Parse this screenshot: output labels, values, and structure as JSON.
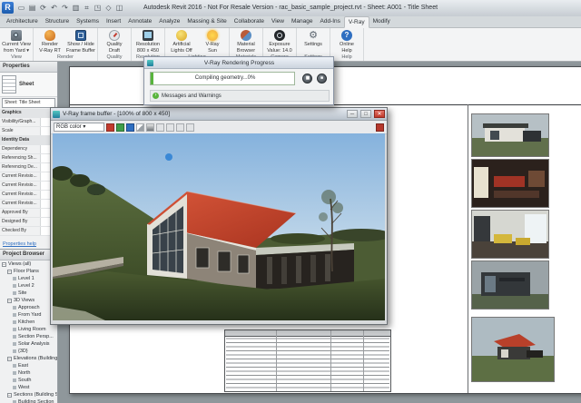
{
  "title_bar": {
    "title": "Autodesk Revit 2016 - Not For Resale Version -   rac_basic_sample_project.rvt - Sheet: A001 - Title Sheet",
    "app_initial": "R",
    "qat": [
      "open",
      "save",
      "sync",
      "undo",
      "redo",
      "print",
      "measure",
      "tag",
      "view-3d",
      "section"
    ]
  },
  "ribbon": {
    "tabs": [
      "Architecture",
      "Structure",
      "Systems",
      "Insert",
      "Annotate",
      "Analyze",
      "Massing & Site",
      "Collaborate",
      "View",
      "Manage",
      "Add-Ins",
      "V-Ray",
      "Modify"
    ],
    "active_tab": "V-Ray",
    "panels": [
      {
        "label": "View",
        "buttons": [
          {
            "line1": "Current View",
            "line2": "from Yard",
            "icon": "camera",
            "dropdown": true
          }
        ]
      },
      {
        "label": "Render",
        "buttons": [
          {
            "line1": "Render",
            "line2": "V-Ray RT",
            "icon": "teapot"
          },
          {
            "line1": "Show / Hide",
            "line2": "Frame Buffer",
            "icon": "framebuffer"
          }
        ]
      },
      {
        "label": "Quality",
        "buttons": [
          {
            "line1": "Quality",
            "line2": "Draft",
            "icon": "quality"
          }
        ]
      },
      {
        "label": "Resolution",
        "buttons": [
          {
            "line1": "Resolution",
            "line2": "800 x 450",
            "icon": "resolution"
          }
        ]
      },
      {
        "label": "Lighting",
        "buttons": [
          {
            "line1": "Artificial",
            "line2": "Lights Off",
            "icon": "bulb"
          },
          {
            "line1": "V-Ray",
            "line2": "Sun",
            "icon": "sun"
          }
        ]
      },
      {
        "label": "Materials",
        "buttons": [
          {
            "line1": "Material",
            "line2": "Browser",
            "icon": "material"
          }
        ]
      },
      {
        "label": "Camera",
        "buttons": [
          {
            "line1": "Exposure",
            "line2": "Value: 14.0",
            "icon": "exposure"
          }
        ]
      },
      {
        "label": "Settings",
        "buttons": [
          {
            "line1": "Settings",
            "line2": "",
            "icon": "gear"
          }
        ]
      },
      {
        "label": "Help",
        "buttons": [
          {
            "line1": "Online",
            "line2": "Help",
            "icon": "help"
          }
        ]
      }
    ]
  },
  "properties_palette": {
    "header": "Properties",
    "thumb_label": "Sheet",
    "selector": "Sheet: Title Sheet",
    "rows": [
      {
        "label": "Graphics",
        "section": true
      },
      {
        "label": "Visibility/Graph..."
      },
      {
        "label": "Scale"
      },
      {
        "label": "Identity Data",
        "section": true
      },
      {
        "label": "Dependency"
      },
      {
        "label": "Referencing Sh..."
      },
      {
        "label": "Referencing De..."
      },
      {
        "label": "Current Revisio..."
      },
      {
        "label": "Current Revisio..."
      },
      {
        "label": "Current Revisio..."
      },
      {
        "label": "Current Revisio..."
      },
      {
        "label": "Approved By"
      },
      {
        "label": "Designed By"
      },
      {
        "label": "Checked By"
      }
    ],
    "footer": "Properties help"
  },
  "project_browser": {
    "header": "Project Browser",
    "items": [
      {
        "label": "Views (all)",
        "depth": 0,
        "expand": true
      },
      {
        "label": "Floor Plans",
        "depth": 1,
        "expand": true
      },
      {
        "label": "Level 1",
        "depth": 2
      },
      {
        "label": "Level 2",
        "depth": 2
      },
      {
        "label": "Site",
        "depth": 2
      },
      {
        "label": "3D Views",
        "depth": 1,
        "expand": true
      },
      {
        "label": "Approach",
        "depth": 2
      },
      {
        "label": "From Yard",
        "depth": 2
      },
      {
        "label": "Kitchen",
        "depth": 2
      },
      {
        "label": "Living Room",
        "depth": 2
      },
      {
        "label": "Section Persp...",
        "depth": 2
      },
      {
        "label": "Solar Analysis",
        "depth": 2
      },
      {
        "label": "{3D}",
        "depth": 2
      },
      {
        "label": "Elevations (Building Elevation)",
        "depth": 1,
        "expand": true
      },
      {
        "label": "East",
        "depth": 2
      },
      {
        "label": "North",
        "depth": 2
      },
      {
        "label": "South",
        "depth": 2
      },
      {
        "label": "West",
        "depth": 2
      },
      {
        "label": "Sections (Building Section)",
        "depth": 1,
        "expand": true
      },
      {
        "label": "Building Section",
        "depth": 2
      }
    ]
  },
  "progress_dialog": {
    "title": "V-Ray Rendering Progress",
    "status": "Compiling geometry...0%",
    "messages": "Messages and Warnings"
  },
  "frame_buffer": {
    "title": "V-Ray frame buffer  -  [100% of 800 x 450]",
    "channel": "RGB color",
    "window_buttons": {
      "minimize": "─",
      "maximize": "□",
      "close": "✕"
    },
    "toolbar_icons": [
      "red-channel",
      "green-channel",
      "blue-channel",
      "alpha-channel",
      "mono-channel",
      "compare",
      "history",
      "color-correction",
      "region",
      "save"
    ]
  },
  "colors": {
    "accent_green": "#58b43c",
    "vray_teal": "#1f7f9e",
    "close_red": "#c0392b",
    "roof_red": "#c4452e"
  }
}
